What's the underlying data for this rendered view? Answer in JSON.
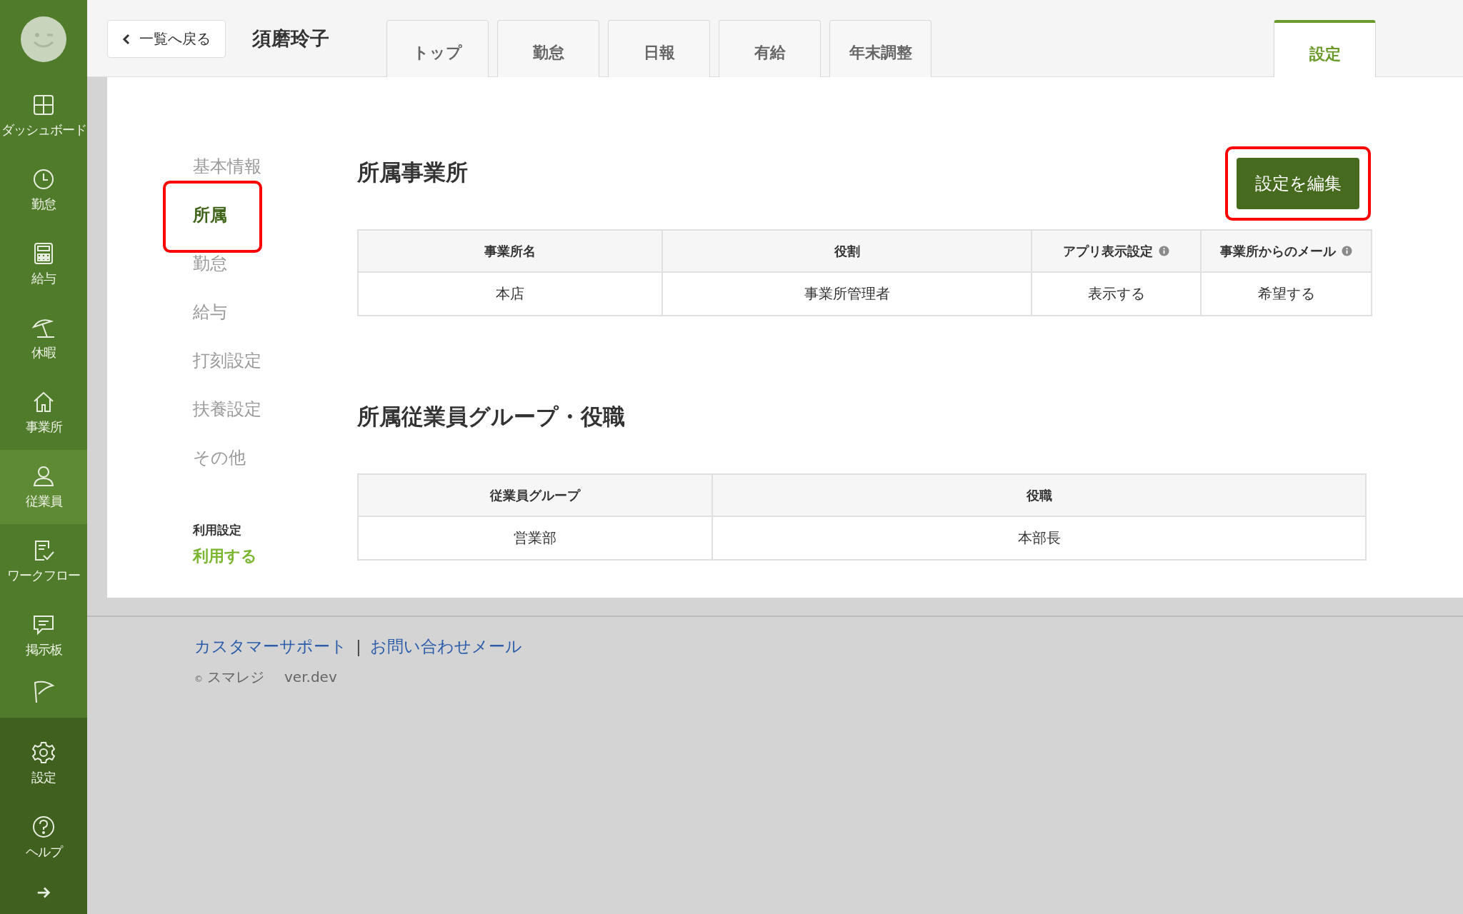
{
  "sidebar": {
    "items": [
      {
        "label": "ダッシュボード",
        "selected": false
      },
      {
        "label": "勤怠",
        "selected": false
      },
      {
        "label": "給与",
        "selected": false
      },
      {
        "label": "休暇",
        "selected": false
      },
      {
        "label": "事業所",
        "selected": false
      },
      {
        "label": "従業員",
        "selected": true
      },
      {
        "label": "ワークフロー",
        "selected": false
      },
      {
        "label": "掲示板",
        "selected": false
      },
      {
        "selected": false
      }
    ],
    "bottom_items": [
      {
        "label": "設定"
      },
      {
        "label": "ヘルプ"
      }
    ]
  },
  "header": {
    "back_button": "一覧へ戻る",
    "employee_name": "須磨玲子",
    "tabs": [
      {
        "label": "トップ",
        "selected": false
      },
      {
        "label": "勤怠",
        "selected": false
      },
      {
        "label": "日報",
        "selected": false
      },
      {
        "label": "有給",
        "selected": false
      },
      {
        "label": "年末調整",
        "selected": false
      },
      {
        "label": "設定",
        "selected": true
      }
    ]
  },
  "side_nav": {
    "items": [
      {
        "label": "基本情報",
        "selected": false,
        "highlighted": false
      },
      {
        "label": "所属",
        "selected": true,
        "highlighted": true
      },
      {
        "label": "勤怠",
        "selected": false,
        "highlighted": false
      },
      {
        "label": "給与",
        "selected": false,
        "highlighted": false
      },
      {
        "label": "打刻設定",
        "selected": false,
        "highlighted": false
      },
      {
        "label": "扶養設定",
        "selected": false,
        "highlighted": false
      },
      {
        "label": "その他",
        "selected": false,
        "highlighted": false
      }
    ],
    "usage_label": "利用設定",
    "usage_value": "利用する"
  },
  "sections": [
    {
      "title": "所属事業所",
      "edit_button": {
        "label": "設定を編集",
        "highlighted": true
      },
      "columns": [
        {
          "label": "事業所名",
          "info": false
        },
        {
          "label": "役割",
          "info": false
        },
        {
          "label": "アプリ表示設定",
          "info": true
        },
        {
          "label": "事業所からのメール",
          "info": true
        }
      ],
      "rows": [
        [
          "本店",
          "事業所管理者",
          "表示する",
          "希望する"
        ]
      ]
    },
    {
      "title": "所属従業員グループ・役職",
      "columns": [
        {
          "label": "従業員グループ",
          "info": false
        },
        {
          "label": "役職",
          "info": false
        }
      ],
      "rows": [
        [
          "営業部",
          "本部長"
        ]
      ]
    }
  ],
  "footer": {
    "links": [
      "カスタマーサポート",
      "お問い合わせメール"
    ],
    "separator": "|",
    "copyright_mark": "©",
    "company": "スマレジ",
    "version": "ver.dev"
  }
}
